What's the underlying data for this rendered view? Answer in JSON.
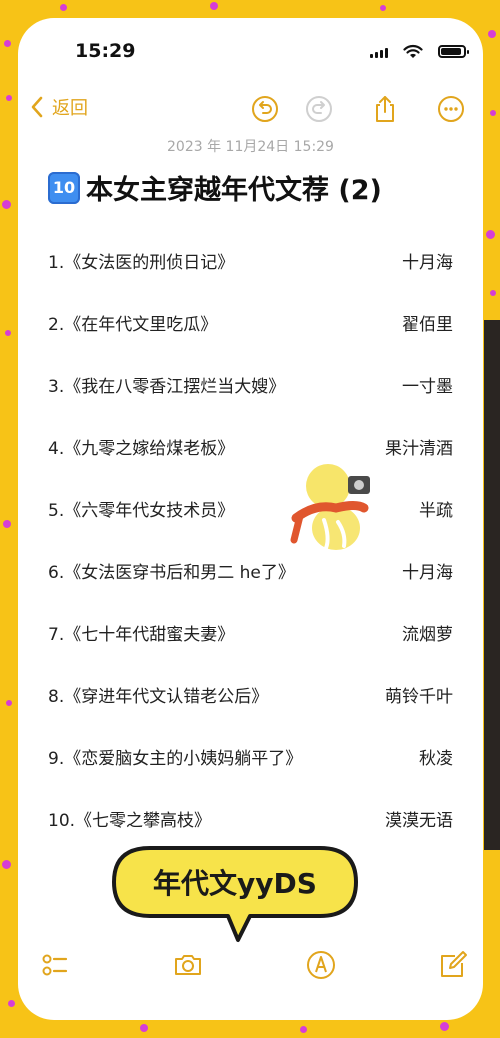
{
  "status": {
    "time": "15:29"
  },
  "nav": {
    "back_label": "返回"
  },
  "note": {
    "date": "2023 年 11月24日 15:29",
    "title_badge": "10",
    "title": "本女主穿越年代文荐 (2)",
    "items": [
      {
        "book": "1.《女法医的刑侦日记》",
        "author": "十月海"
      },
      {
        "book": "2.《在年代文里吃瓜》",
        "author": "翟佰里"
      },
      {
        "book": "3.《我在八零香江摆烂当大嫂》",
        "author": "一寸墨"
      },
      {
        "book": "4.《九零之嫁给煤老板》",
        "author": "果汁清酒"
      },
      {
        "book": "5.《六零年代女技术员》",
        "author": "半疏"
      },
      {
        "book": "6.《女法医穿书后和男二 he了》",
        "author": "十月海"
      },
      {
        "book": "7.《七十年代甜蜜夫妻》",
        "author": "流烟萝"
      },
      {
        "book": "8.《穿进年代文认错老公后》",
        "author": "萌铃千叶"
      },
      {
        "book": "9.《恋爱脑女主的小姨妈躺平了》",
        "author": "秋凌"
      },
      {
        "book": "10.《七零之攀高枝》",
        "author": "漠漠无语"
      }
    ]
  },
  "bubble": {
    "text": "年代文yyDS"
  },
  "icons": {
    "back": "chevron-left-icon",
    "undo": "undo-icon",
    "redo": "redo-icon",
    "share": "share-icon",
    "more": "more-icon",
    "checklist": "checklist-icon",
    "camera": "camera-icon",
    "markup": "markup-pen-icon",
    "compose": "compose-icon",
    "sticker": "duck-sticker-icon"
  },
  "colors": {
    "accent": "#e1a51d",
    "background": "#f7c317",
    "dots": "#d63ed6",
    "keycap": "#3f8ef0"
  }
}
